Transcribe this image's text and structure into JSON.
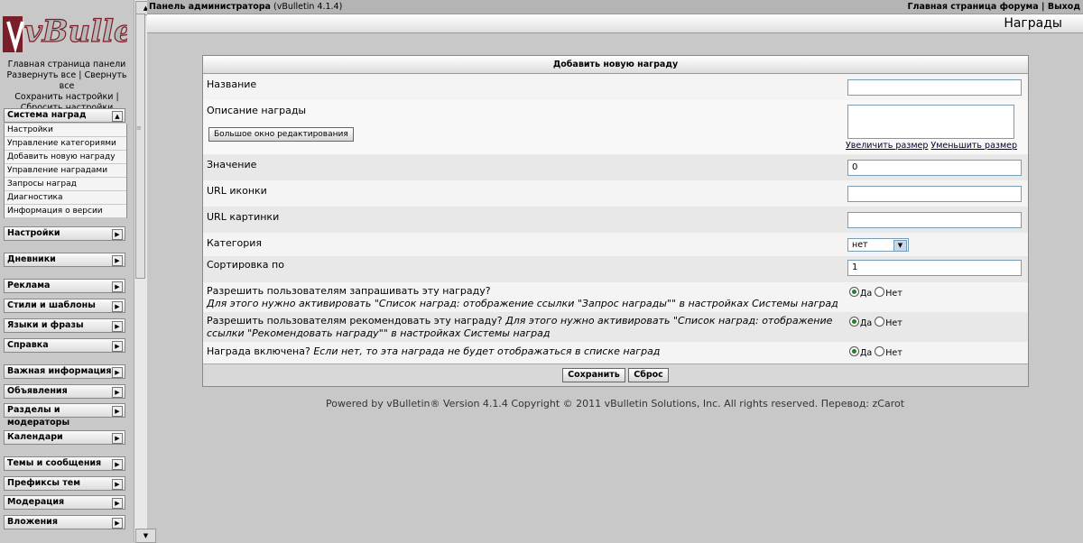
{
  "sidebar": {
    "logo_text": "vBulletin",
    "links": [
      "Главная страница панели",
      "Развернуть все",
      "Свернуть все",
      "Сохранить настройки",
      "Сбросить настройки"
    ],
    "open_group": {
      "label": "Система наград",
      "items": [
        "Настройки",
        "Управление категориями",
        "Добавить новую награду",
        "Управление наградами",
        "Запросы наград",
        "Диагностика",
        "Информация о версии"
      ]
    },
    "groups": [
      "Настройки",
      "Дневники",
      "Реклама",
      "Стили и шаблоны",
      "Языки и фразы",
      "Справка",
      "Важная информация",
      "Объявления",
      "Разделы и модераторы",
      "Календари",
      "Темы и сообщения",
      "Префиксы тем",
      "Модерация",
      "Вложения"
    ]
  },
  "topbar": {
    "title_bold": "Панель администратора",
    "version": "(vBulletin 4.1.4)",
    "forum_home": "Главная страница форума",
    "separator": "|",
    "logout": "Выход"
  },
  "page_title": "Награды",
  "form": {
    "header": "Добавить новую награду",
    "name_label": "Название",
    "name_value": "",
    "desc_label": "Описание награды",
    "desc_value": "",
    "big_editor_button": "Большое окно редактирования",
    "enlarge_link": "Увеличить размер",
    "shrink_link": "Уменьшить размер",
    "value_label": "Значение",
    "value_value": "0",
    "icon_url_label": "URL иконки",
    "icon_url_value": "",
    "image_url_label": "URL картинки",
    "image_url_value": "",
    "category_label": "Категория",
    "category_value": "нет",
    "sort_label": "Сортировка по",
    "sort_value": "1",
    "request_label": "Разрешить пользователям запрашивать эту награду?",
    "request_desc": "Для этого нужно активировать \"Список наград: отображение ссылки \"Запрос награды\"\" в настройках Системы наград",
    "recommend_label": "Разрешить пользователям рекомендовать эту награду?",
    "recommend_desc_a": "Для этого нужно активировать \"Список наград: отображение",
    "recommend_desc_b": "ссылки \"Рекомендовать награду\"\" в настройках Системы наград",
    "enabled_label": "Награда включена?",
    "enabled_desc": "Если нет, то эта награда не будет отображаться в списке наград",
    "yes": "Да",
    "no": "Нет",
    "save_button": "Сохранить",
    "reset_button": "Сброс"
  },
  "footer": {
    "powered": "Powered by vBulletin® Version 4.1.4 Copyright © 2011 vBulletin Solutions, Inc. All rights reserved. Перевод: zCarot"
  },
  "colors": {
    "background": "#c8c8c8",
    "radio_selected": "#2c7a2c",
    "logo_red": "#7a1e2a"
  }
}
